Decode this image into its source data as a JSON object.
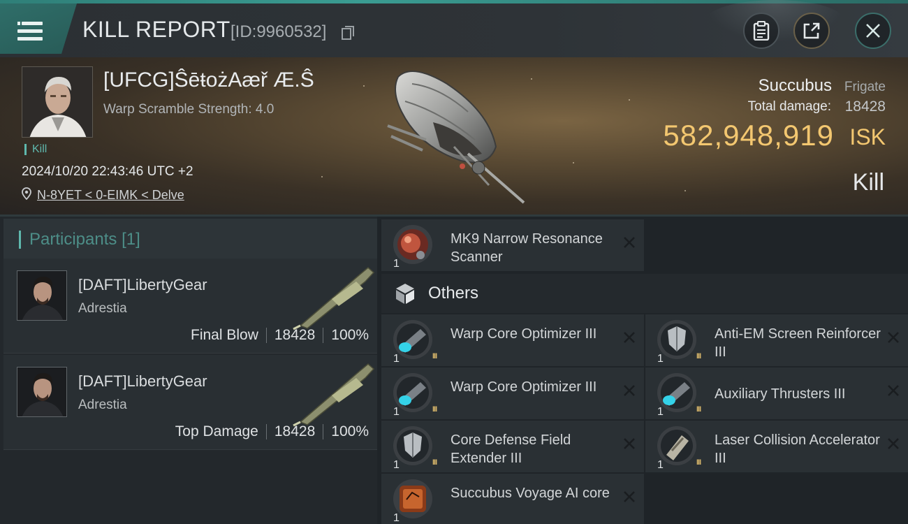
{
  "header": {
    "title": "KILL REPORT",
    "report_id": "[ID:9960532]"
  },
  "victim": {
    "name": "[UFCG]ŜēŧożAæř Æ.Ŝ",
    "warp_strength": "Warp Scramble Strength: 4.0",
    "kill_tag": "Kill",
    "datetime": "2024/10/20 22:43:46 UTC +2",
    "location": "N-8YET < 0-EIMK < Delve",
    "ship": "Succubus",
    "ship_class": "Frigate",
    "total_damage_label": "Total damage:",
    "total_damage": "18428",
    "isk_value": "582,948,919",
    "isk_unit": "ISK",
    "result": "Kill"
  },
  "participants": {
    "title": "Participants",
    "count": "[1]",
    "rows": [
      {
        "name": "[DAFT]LibertyGear",
        "ship": "Adrestia",
        "role": "Final Blow",
        "damage": "18428",
        "percent": "100%"
      },
      {
        "name": "[DAFT]LibertyGear",
        "ship": "Adrestia",
        "role": "Top Damage",
        "damage": "18428",
        "percent": "100%"
      }
    ]
  },
  "items": {
    "top_item": {
      "name": "MK9 Narrow Resonance Scanner",
      "qty": "1"
    },
    "others_label": "Others",
    "others": [
      {
        "name": "Warp Core Optimizer III",
        "qty": "1",
        "tier": "III"
      },
      {
        "name": "Anti-EM Screen Reinforcer III",
        "qty": "1",
        "tier": "III"
      },
      {
        "name": "Warp Core Optimizer III",
        "qty": "1",
        "tier": "III"
      },
      {
        "name": "Auxiliary Thrusters III",
        "qty": "1",
        "tier": "III"
      },
      {
        "name": "Core Defense Field Extender III",
        "qty": "1",
        "tier": "III"
      },
      {
        "name": "Laser Collision Accelerator III",
        "qty": "1",
        "tier": "III"
      },
      {
        "name": "Succubus Voyage AI core",
        "qty": "1"
      }
    ]
  }
}
